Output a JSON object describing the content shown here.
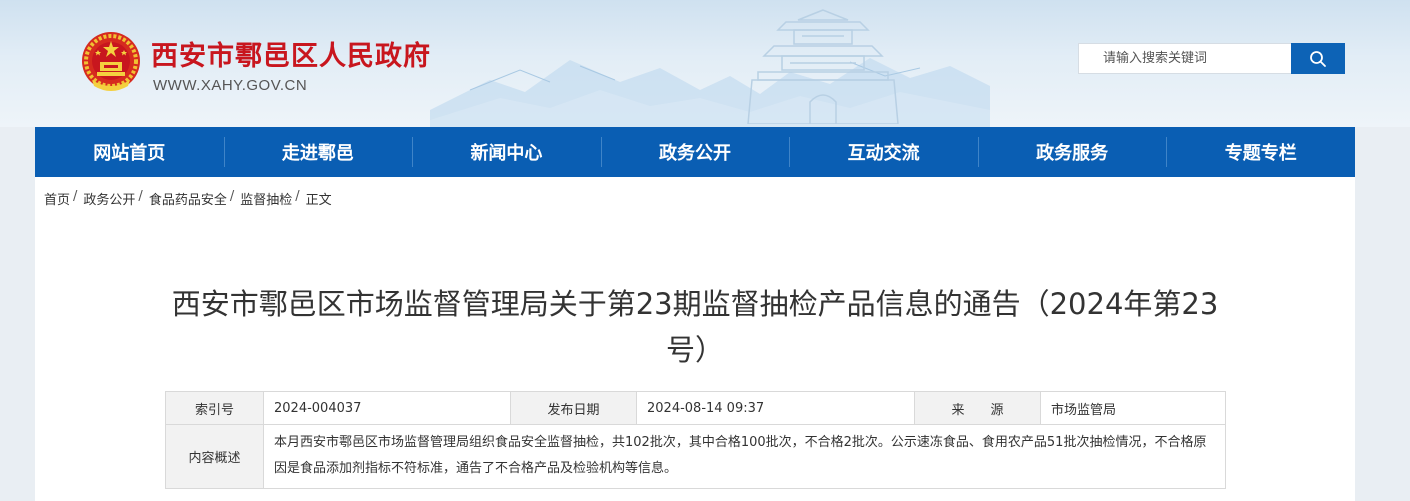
{
  "header": {
    "site_title": "西安市鄠邑区人民政府",
    "site_url": "WWW.XAHY.GOV.CN",
    "search_placeholder": "请输入搜索关键词",
    "emblem_icon": "national-emblem-icon",
    "search_icon": "search-icon"
  },
  "nav": {
    "items": [
      "网站首页",
      "走进鄠邑",
      "新闻中心",
      "政务公开",
      "互动交流",
      "政务服务",
      "专题专栏"
    ]
  },
  "breadcrumb": {
    "items": [
      "首页",
      "政务公开",
      "食品药品安全",
      "监督抽检"
    ],
    "separator": "/",
    "current": "正文"
  },
  "article": {
    "title": "西安市鄠邑区市场监督管理局关于第23期监督抽检产品信息的通告（2024年第23号）",
    "meta": {
      "index_label": "索引号",
      "index_value": "2024-004037",
      "date_label": "发布日期",
      "date_value": "2024-08-14 09:37",
      "source_label": "来　　源",
      "source_value": "市场监管局",
      "summary_label": "内容概述",
      "summary_value": "本月西安市鄠邑区市场监督管理局组织食品安全监督抽检，共102批次，其中合格100批次，不合格2批次。公示速冻食品、食用农产品51批次抽检情况，不合格原因是食品添加剂指标不符标准，通告了不合格产品及检验机构等信息。"
    }
  },
  "colors": {
    "nav_bg": "#0a5eb3",
    "title_red": "#c8161e",
    "search_button": "#0d63b6"
  }
}
